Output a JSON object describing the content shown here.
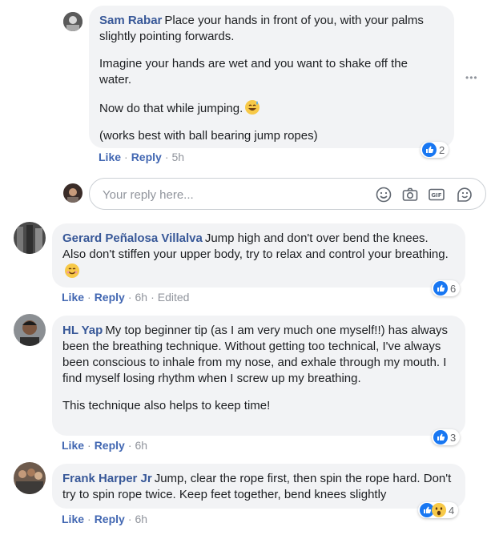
{
  "comments": [
    {
      "author": "Sam Rabar",
      "para1": "Place your hands in front of you, with your palms slightly pointing forwards.",
      "para2": "Imagine your hands are wet and you want to shake off the water.",
      "para3": "Now do that while jumping.",
      "para4": "(works best with ball bearing jump ropes)",
      "like": "Like",
      "reply": "Reply",
      "time": "5h",
      "reactions": "2"
    },
    {
      "author": "Gerard Peñalosa Villalva",
      "para1": "Jump high and don't over bend the knees. Also don't stiffen your upper body, try to relax and control your breathing.",
      "like": "Like",
      "reply": "Reply",
      "time": "6h",
      "edited": "Edited",
      "reactions": "6"
    },
    {
      "author": "HL Yap",
      "para1": "My top beginner tip (as I am very much one myself!!) has always been the breathing technique. Without getting too technical, I've always been conscious to inhale from my nose, and exhale through my mouth. I find myself losing rhythm when I screw up my breathing.",
      "para2": "This technique also helps to keep time!",
      "like": "Like",
      "reply": "Reply",
      "time": "6h",
      "reactions": "3"
    },
    {
      "author": "Frank Harper Jr",
      "para1": "Jump, clear the rope first, then spin the rope hard. Don't try to spin rope twice. Keep feet together, bend knees slightly",
      "like": "Like",
      "reply": "Reply",
      "time": "6h",
      "reactions": "4"
    }
  ],
  "reply_box": {
    "placeholder": "Your reply here..."
  },
  "more_options": "•••",
  "icons": [
    "like-icon",
    "wow-icon",
    "sweat-smile-icon",
    "smile-icon",
    "emoji-icon",
    "camera-icon",
    "gif-icon",
    "sticker-icon",
    "more-options-icon"
  ],
  "colors": {
    "link": "#385898",
    "action": "#4267b2",
    "like_blue": "#1877f2",
    "bubble": "#f2f3f5",
    "muted": "#90949c"
  }
}
